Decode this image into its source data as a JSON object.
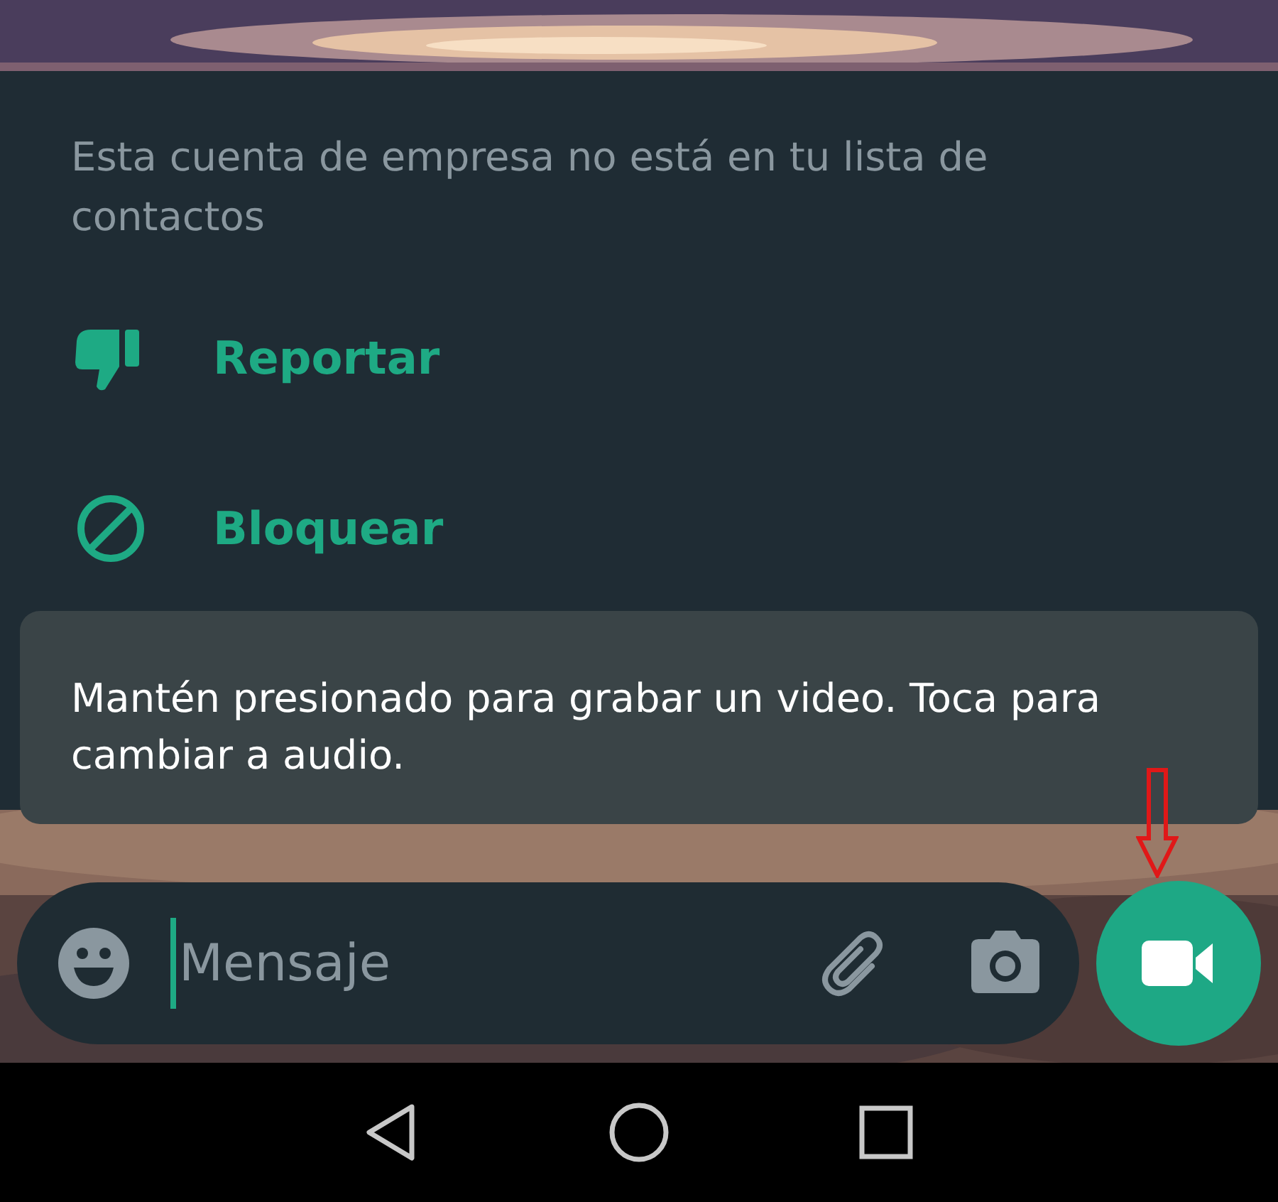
{
  "notice": "Esta cuenta de empresa no está en tu lista de contactos",
  "actions": [
    {
      "kind": "report",
      "label": "Reportar"
    },
    {
      "kind": "block",
      "label": "Bloquear"
    }
  ],
  "tooltip": "Mantén presionado para grabar un video. Toca para cambiar a audio.",
  "composer": {
    "placeholder": "Mensaje"
  }
}
